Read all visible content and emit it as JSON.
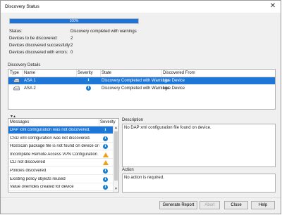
{
  "window": {
    "title": "Discovery Status",
    "close_glyph": "✕"
  },
  "progress": {
    "value": 1.0,
    "label": "100%",
    "color": "#1f73d8"
  },
  "summary": [
    {
      "label": "Status:",
      "value": "Discovery completed with warnings"
    },
    {
      "label": "Devices to be discovered:",
      "value": "2"
    },
    {
      "label": "Devices discovered successfully:",
      "value": "2"
    },
    {
      "label": "Devices discovered with errors:",
      "value": "0"
    }
  ],
  "details": {
    "title": "Discovery Details",
    "columns": [
      "Type",
      "Name",
      "Severity",
      "State",
      "Discovered From"
    ],
    "rows": [
      {
        "name": "ASA 1",
        "severity_icon": "info-icon",
        "state": "Discovery Completed with Warnings",
        "from": "Live Device",
        "selected": true
      },
      {
        "name": "ASA 2",
        "severity_icon": "info-icon",
        "state": "Discovery Completed with Warnings",
        "from": "Live Device",
        "selected": false
      }
    ]
  },
  "splitter_glyph": "▼▲",
  "messages": {
    "columns": [
      "Messages",
      "Severity"
    ],
    "rows": [
      {
        "text": "DAP xml configuration was not discovered.",
        "icon": "info-icon",
        "selected": true
      },
      {
        "text": "CSD xml configuration was not discovered.",
        "icon": "info-icon",
        "selected": false
      },
      {
        "text": "Hostscan package file is not found on device or not ...",
        "icon": "info-icon",
        "selected": false
      },
      {
        "text": "Incomplete Remote Access VPN Configuration",
        "icon": "warning-icon",
        "selected": false
      },
      {
        "text": "CLI not discovered",
        "icon": "warning-icon",
        "selected": false
      },
      {
        "text": "Policies discovered",
        "icon": "info-icon",
        "selected": false
      },
      {
        "text": "Existing policy objects reused",
        "icon": "info-icon",
        "selected": false
      },
      {
        "text": "Value overrides created for device",
        "icon": "info-icon",
        "selected": false
      }
    ]
  },
  "description": {
    "label": "Description",
    "text": "No DAP xml configuration file found on device."
  },
  "action": {
    "label": "Action",
    "text": "No action is required."
  },
  "buttons": {
    "generate_report": "Generate Report",
    "abort": "Abort",
    "close": "Close",
    "help": "Help"
  },
  "colors": {
    "selection": "#1e77d6",
    "info": "#1c7fd1",
    "warning": "#f0a020"
  }
}
